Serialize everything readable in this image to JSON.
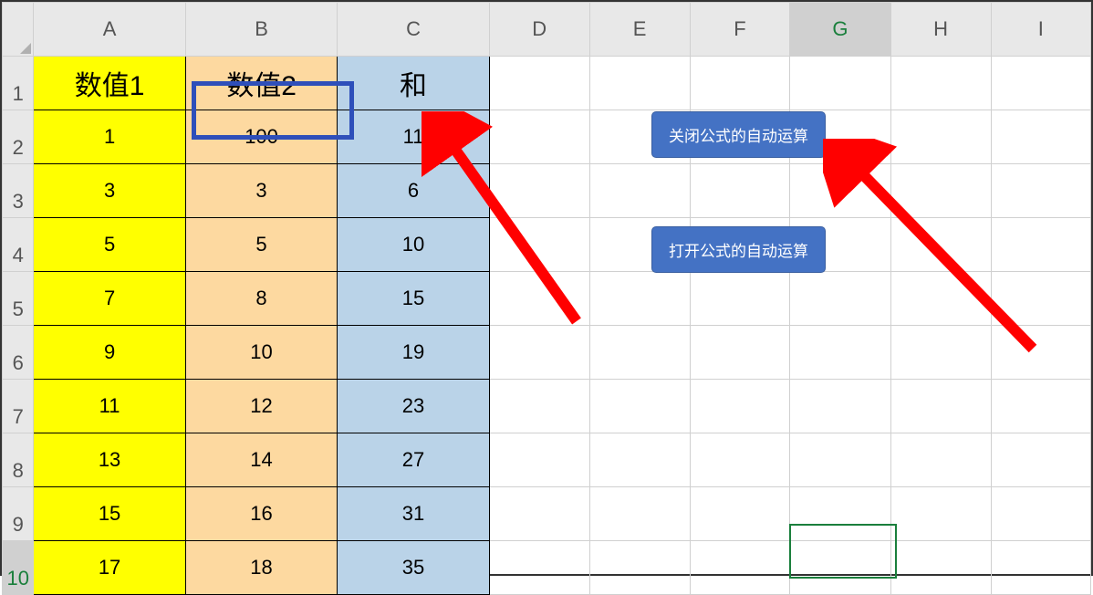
{
  "columns": [
    "A",
    "B",
    "C",
    "D",
    "E",
    "F",
    "G",
    "H",
    "I"
  ],
  "rows": [
    "1",
    "2",
    "3",
    "4",
    "5",
    "6",
    "7",
    "8",
    "9",
    "10"
  ],
  "headers": {
    "A": "数值1",
    "B": "数值2",
    "C": "和"
  },
  "data": [
    {
      "A": "1",
      "B": "100",
      "C": "11"
    },
    {
      "A": "3",
      "B": "3",
      "C": "6"
    },
    {
      "A": "5",
      "B": "5",
      "C": "10"
    },
    {
      "A": "7",
      "B": "8",
      "C": "15"
    },
    {
      "A": "9",
      "B": "10",
      "C": "19"
    },
    {
      "A": "11",
      "B": "12",
      "C": "23"
    },
    {
      "A": "13",
      "B": "14",
      "C": "27"
    },
    {
      "A": "15",
      "B": "16",
      "C": "31"
    },
    {
      "A": "17",
      "B": "18",
      "C": "35"
    }
  ],
  "callouts": {
    "top": "关闭公式的自动运算",
    "bottom": "打开公式的自动运算"
  },
  "selected_cell": "B2",
  "active_cell": "G10"
}
